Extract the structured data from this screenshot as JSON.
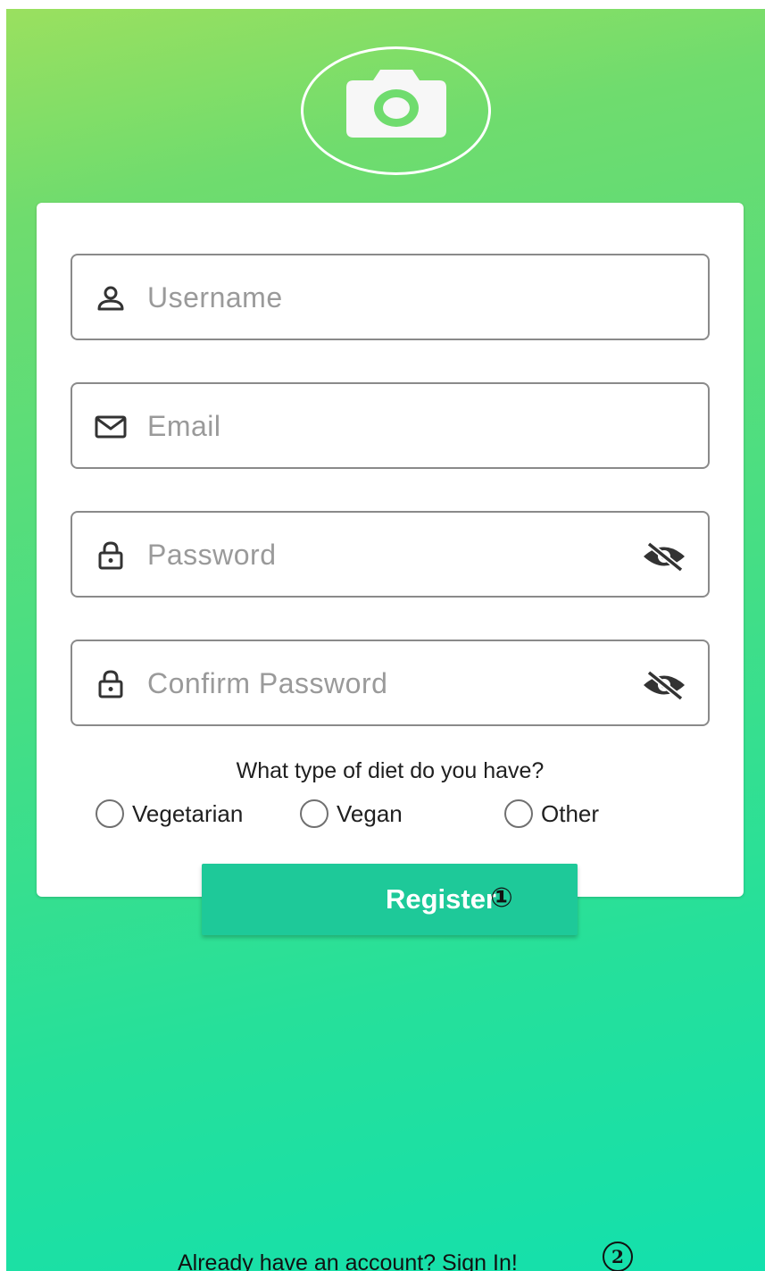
{
  "header": {
    "logo_icon": "camera-icon"
  },
  "form": {
    "username": {
      "placeholder": "Username",
      "icon": "person-icon"
    },
    "email": {
      "placeholder": "Email",
      "icon": "mail-icon"
    },
    "password": {
      "placeholder": "Password",
      "icon": "lock-icon",
      "toggle_icon": "eye-off-icon"
    },
    "confirm_password": {
      "placeholder": "Confirm Password",
      "icon": "lock-icon",
      "toggle_icon": "eye-off-icon"
    },
    "diet": {
      "question": "What type of diet do you have?",
      "options": [
        "Vegetarian",
        "Vegan",
        "Other"
      ]
    }
  },
  "register_button": {
    "label": "Register",
    "badge": "①"
  },
  "footer": {
    "signin_text": "Already have an account? Sign In!",
    "badge": "2"
  },
  "colors": {
    "gradient_top": "#9ae05f",
    "gradient_bottom": "#13e0ad",
    "button": "#1ec999",
    "field_border": "#8a8a8a",
    "placeholder": "#9a9a9a"
  }
}
